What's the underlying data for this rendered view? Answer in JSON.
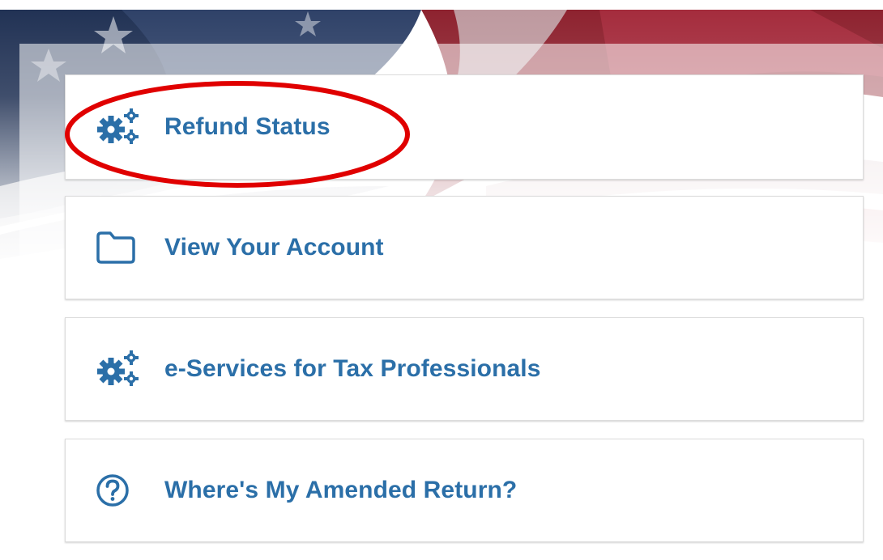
{
  "menu": {
    "items": [
      {
        "label": "Refund Status",
        "icon": "gears-icon"
      },
      {
        "label": "View Your Account",
        "icon": "folder-icon"
      },
      {
        "label": "e-Services for Tax Professionals",
        "icon": "gears-icon"
      },
      {
        "label": "Where's My Amended Return?",
        "icon": "question-circle-icon"
      }
    ]
  },
  "colors": {
    "link": "#2b6fa8",
    "highlight": "#e00000",
    "card_border": "#dcdcdc"
  }
}
